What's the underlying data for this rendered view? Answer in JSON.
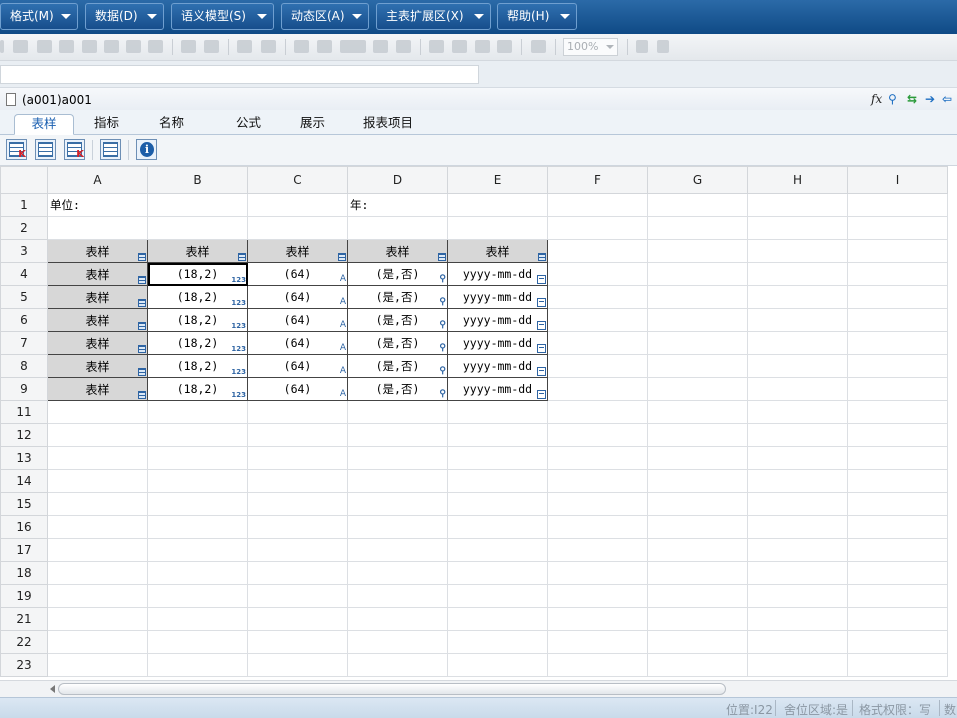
{
  "menus": [
    {
      "label": "格式(M)"
    },
    {
      "label": "数据(D)"
    },
    {
      "label": "语义模型(S)"
    },
    {
      "label": "动态区(A)"
    },
    {
      "label": "主表扩展区(X)"
    },
    {
      "label": "帮助(H)"
    }
  ],
  "toolbar": {
    "zoom": "100%"
  },
  "document": {
    "title": "(a001)a001",
    "fx_label": "fx"
  },
  "tabs": [
    {
      "label": "表样"
    },
    {
      "label": "指标"
    },
    {
      "label": "名称"
    },
    {
      "label": "公式"
    },
    {
      "label": "展示"
    },
    {
      "label": "报表项目"
    }
  ],
  "sheet": {
    "columns": [
      "A",
      "B",
      "C",
      "D",
      "E",
      "F",
      "G",
      "H",
      "I"
    ],
    "rows": [
      {
        "num": "1",
        "cells": [
          "单位:",
          "",
          "",
          "年:",
          "",
          "",
          "",
          "",
          ""
        ]
      },
      {
        "num": "2",
        "cells": [
          "",
          "",
          "",
          "",
          "",
          "",
          "",
          "",
          ""
        ]
      },
      {
        "num": "3",
        "cells": [
          "表样",
          "表样",
          "表样",
          "表样",
          "表样",
          "",
          "",
          "",
          ""
        ]
      },
      {
        "num": "4",
        "cells": [
          "表样",
          "(18,2)",
          "(64)",
          "(是,否)",
          "yyyy-mm-dd",
          "",
          "",
          "",
          ""
        ]
      },
      {
        "num": "5",
        "cells": [
          "表样",
          "(18,2)",
          "(64)",
          "(是,否)",
          "yyyy-mm-dd",
          "",
          "",
          "",
          ""
        ]
      },
      {
        "num": "6",
        "cells": [
          "表样",
          "(18,2)",
          "(64)",
          "(是,否)",
          "yyyy-mm-dd",
          "",
          "",
          "",
          ""
        ]
      },
      {
        "num": "7",
        "cells": [
          "表样",
          "(18,2)",
          "(64)",
          "(是,否)",
          "yyyy-mm-dd",
          "",
          "",
          "",
          ""
        ]
      },
      {
        "num": "8",
        "cells": [
          "表样",
          "(18,2)",
          "(64)",
          "(是,否)",
          "yyyy-mm-dd",
          "",
          "",
          "",
          ""
        ]
      },
      {
        "num": "9",
        "cells": [
          "表样",
          "(18,2)",
          "(64)",
          "(是,否)",
          "yyyy-mm-dd",
          "",
          "",
          "",
          ""
        ]
      },
      {
        "num": "11",
        "cells": [
          "",
          "",
          "",
          "",
          "",
          "",
          "",
          "",
          ""
        ]
      },
      {
        "num": "12",
        "cells": [
          "",
          "",
          "",
          "",
          "",
          "",
          "",
          "",
          ""
        ]
      },
      {
        "num": "13",
        "cells": [
          "",
          "",
          "",
          "",
          "",
          "",
          "",
          "",
          ""
        ]
      },
      {
        "num": "14",
        "cells": [
          "",
          "",
          "",
          "",
          "",
          "",
          "",
          "",
          ""
        ]
      },
      {
        "num": "15",
        "cells": [
          "",
          "",
          "",
          "",
          "",
          "",
          "",
          "",
          ""
        ]
      },
      {
        "num": "16",
        "cells": [
          "",
          "",
          "",
          "",
          "",
          "",
          "",
          "",
          ""
        ]
      },
      {
        "num": "17",
        "cells": [
          "",
          "",
          "",
          "",
          "",
          "",
          "",
          "",
          ""
        ]
      },
      {
        "num": "18",
        "cells": [
          "",
          "",
          "",
          "",
          "",
          "",
          "",
          "",
          ""
        ]
      },
      {
        "num": "19",
        "cells": [
          "",
          "",
          "",
          "",
          "",
          "",
          "",
          "",
          ""
        ]
      },
      {
        "num": "21",
        "cells": [
          "",
          "",
          "",
          "",
          "",
          "",
          "",
          "",
          ""
        ]
      },
      {
        "num": "22",
        "cells": [
          "",
          "",
          "",
          "",
          "",
          "",
          "",
          "",
          ""
        ]
      },
      {
        "num": "23",
        "cells": [
          "",
          "",
          "",
          "",
          "",
          "",
          "",
          "",
          ""
        ]
      }
    ]
  },
  "status": {
    "position": "位置:I22",
    "region": "舍位区域:是",
    "permission": "格式权限：写",
    "extra": "数"
  },
  "colors": {
    "menubar": "#0f4a86",
    "header_fill": "#d7d7d7",
    "tag_blue": "#2e64a3",
    "accent_tab": "#1a5fb0"
  }
}
